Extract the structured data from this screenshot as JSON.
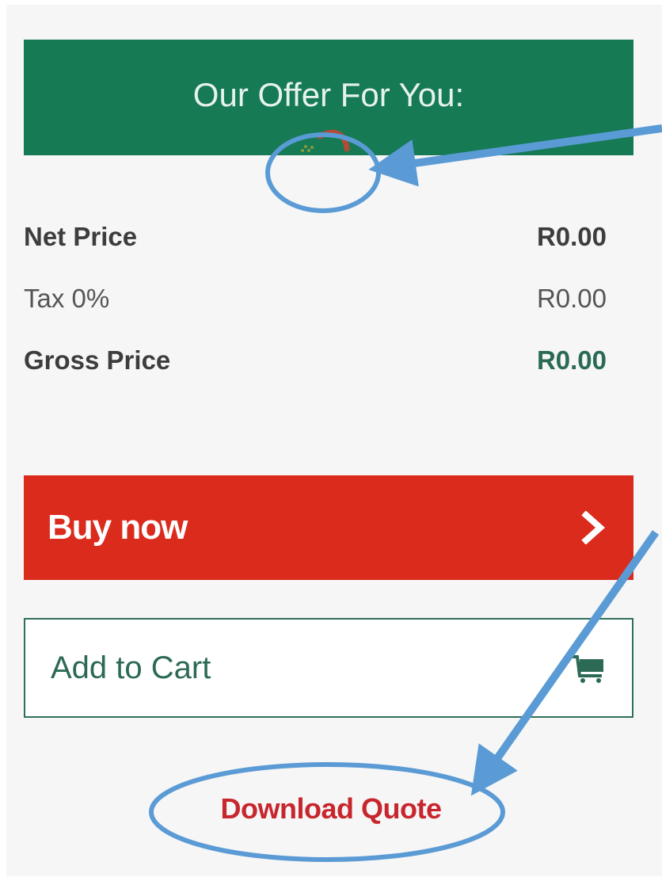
{
  "offer": {
    "title": "Our Offer For You:"
  },
  "prices": {
    "net": {
      "label": "Net Price",
      "value": "R0.00"
    },
    "tax": {
      "label": "Tax 0%",
      "value": "R0.00"
    },
    "gross": {
      "label": "Gross Price",
      "value": "R0.00"
    }
  },
  "actions": {
    "buy_label": "Buy now",
    "buy_icon": "chevron-right-icon",
    "cart_label": "Add to Cart",
    "cart_icon": "shopping-cart-icon",
    "download_label": "Download Quote"
  },
  "colors": {
    "brand_green": "#167a55",
    "buy_red": "#db2b1c",
    "link_red": "#c8262d",
    "annotation_blue": "#5b9bd5"
  }
}
